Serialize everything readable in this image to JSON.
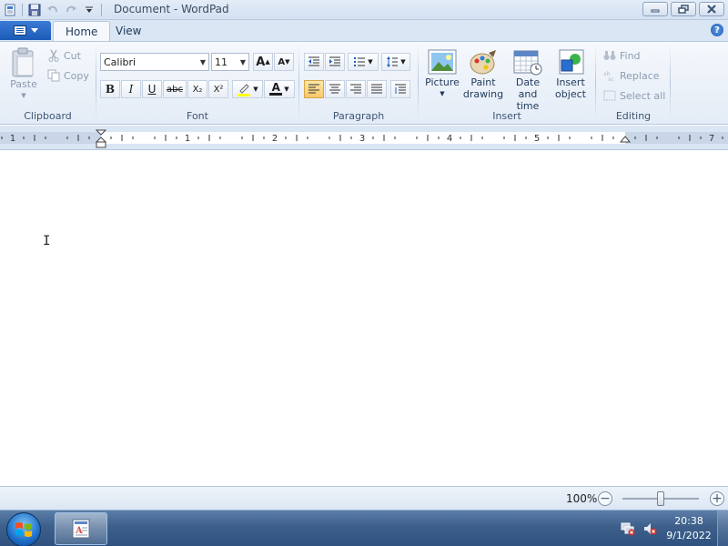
{
  "window": {
    "title": "Document - WordPad"
  },
  "tabs": [
    {
      "label": "Home"
    },
    {
      "label": "View"
    }
  ],
  "ribbon": {
    "clipboard": {
      "label": "Clipboard",
      "paste": "Paste",
      "cut": "Cut",
      "copy": "Copy"
    },
    "font": {
      "label": "Font",
      "family": "Calibri",
      "size": "11",
      "bold": "B",
      "italic": "I",
      "underline": "U",
      "strikethrough": "abc",
      "subscript": "X₂",
      "superscript": "X²",
      "grow": "A",
      "shrink": "A",
      "color_letter": "A"
    },
    "paragraph": {
      "label": "Paragraph"
    },
    "insert": {
      "label": "Insert",
      "picture": "Picture",
      "paint_line1": "Paint",
      "paint_line2": "drawing",
      "datetime_line1": "Date and",
      "datetime_line2": "time",
      "object_line1": "Insert",
      "object_line2": "object"
    },
    "editing": {
      "label": "Editing",
      "find": "Find",
      "replace": "Replace",
      "select_all": "Select all"
    }
  },
  "ruler": {
    "labels": [
      "1",
      "1",
      "2",
      "3",
      "4",
      "5",
      "7"
    ]
  },
  "status": {
    "zoom": "100%",
    "zoom_level": 1.0
  },
  "taskbar": {
    "time": "20:38",
    "date": "9/1/2022"
  },
  "colors": {
    "accent": "#1c5bb7",
    "ribbon_bg": "#e4ecf7",
    "selected_align": "#f8c867",
    "font_color_bar": "#c00000",
    "highlight_bar": "#ffff00"
  }
}
